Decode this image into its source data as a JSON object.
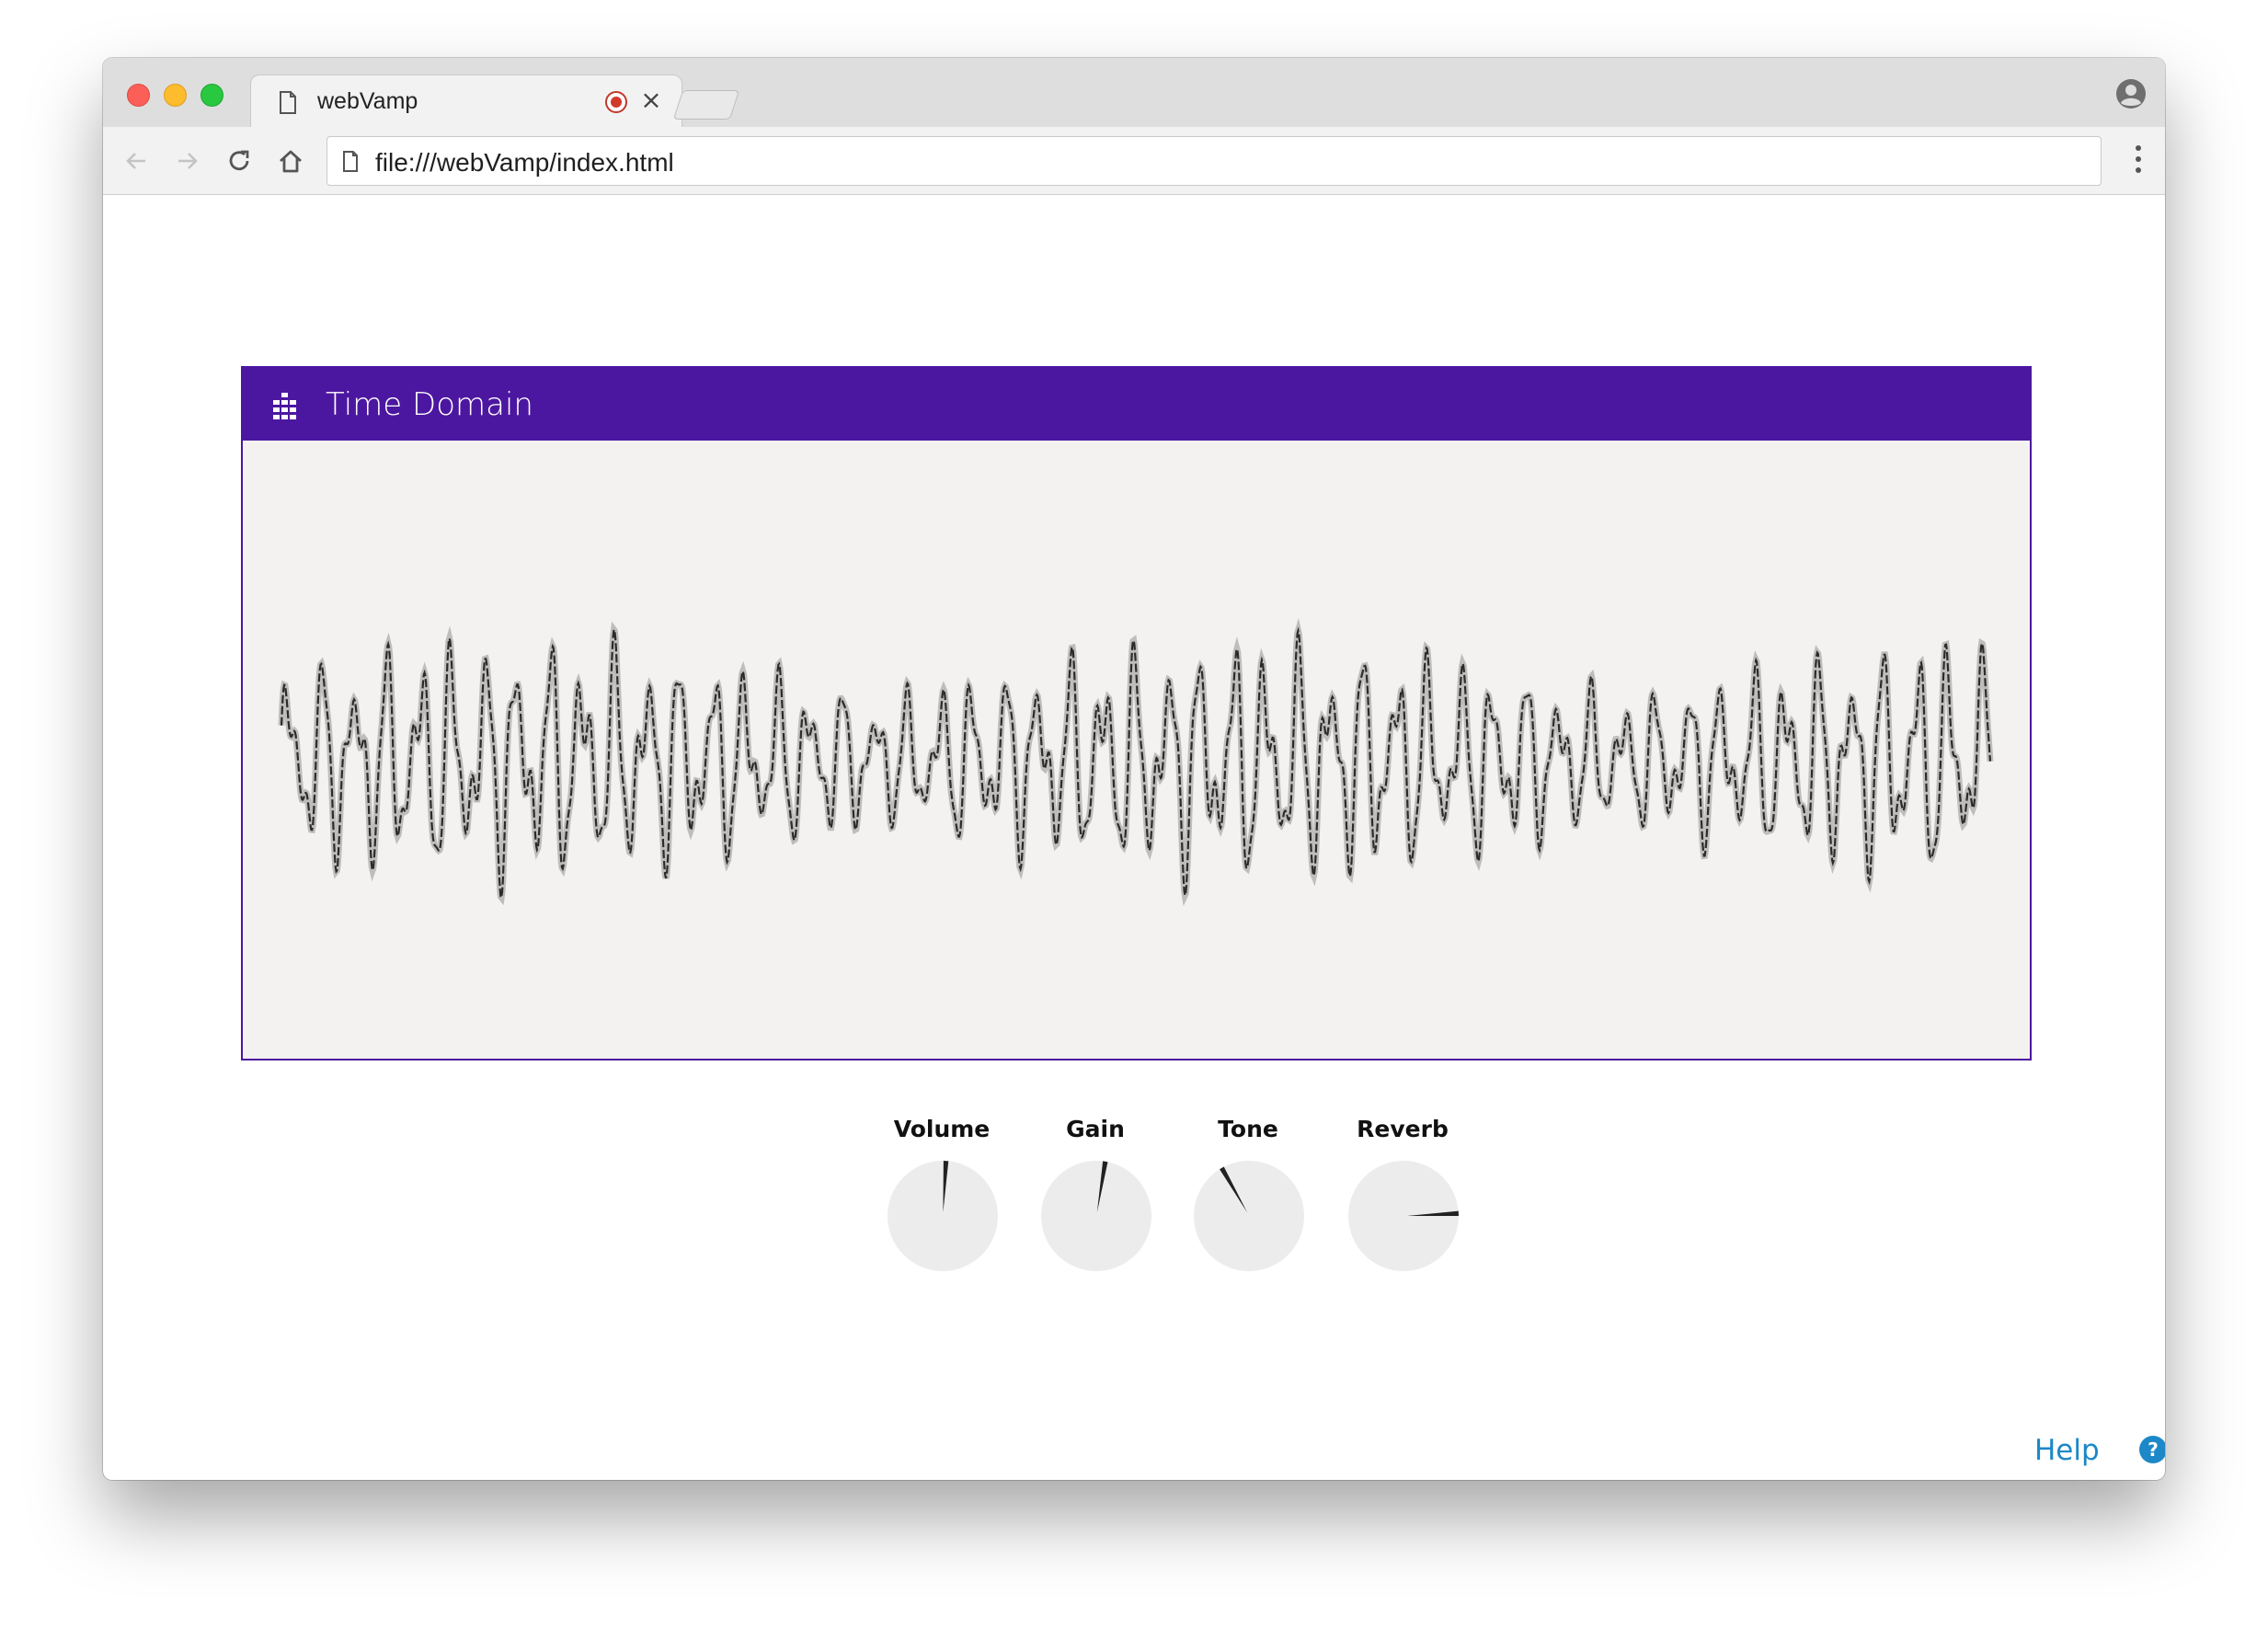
{
  "browser": {
    "tab_title": "webVamp",
    "tab_close": "×",
    "url": "file:///webVamp/index.html"
  },
  "icons": {
    "tab_page": "document-icon",
    "recording": "record-icon",
    "profile": "user-account-icon",
    "back": "arrow-left-icon",
    "forward": "arrow-right-icon",
    "reload": "reload-icon",
    "home": "home-icon",
    "url_page": "document-icon",
    "menu": "vertical-dots-icon",
    "panel": "equalizer-icon",
    "help": "question-circle-icon"
  },
  "panel": {
    "title": "Time Domain",
    "header_color": "#4c17a0",
    "background_color": "#f4f2f1"
  },
  "knobs": [
    {
      "label": "Volume",
      "value": 0.52
    },
    {
      "label": "Gain",
      "value": 0.54
    },
    {
      "label": "Tone",
      "value": 0.41
    },
    {
      "label": "Reverb",
      "value": 0.8
    }
  ],
  "help": {
    "label": "Help",
    "color": "#1c88c7"
  }
}
